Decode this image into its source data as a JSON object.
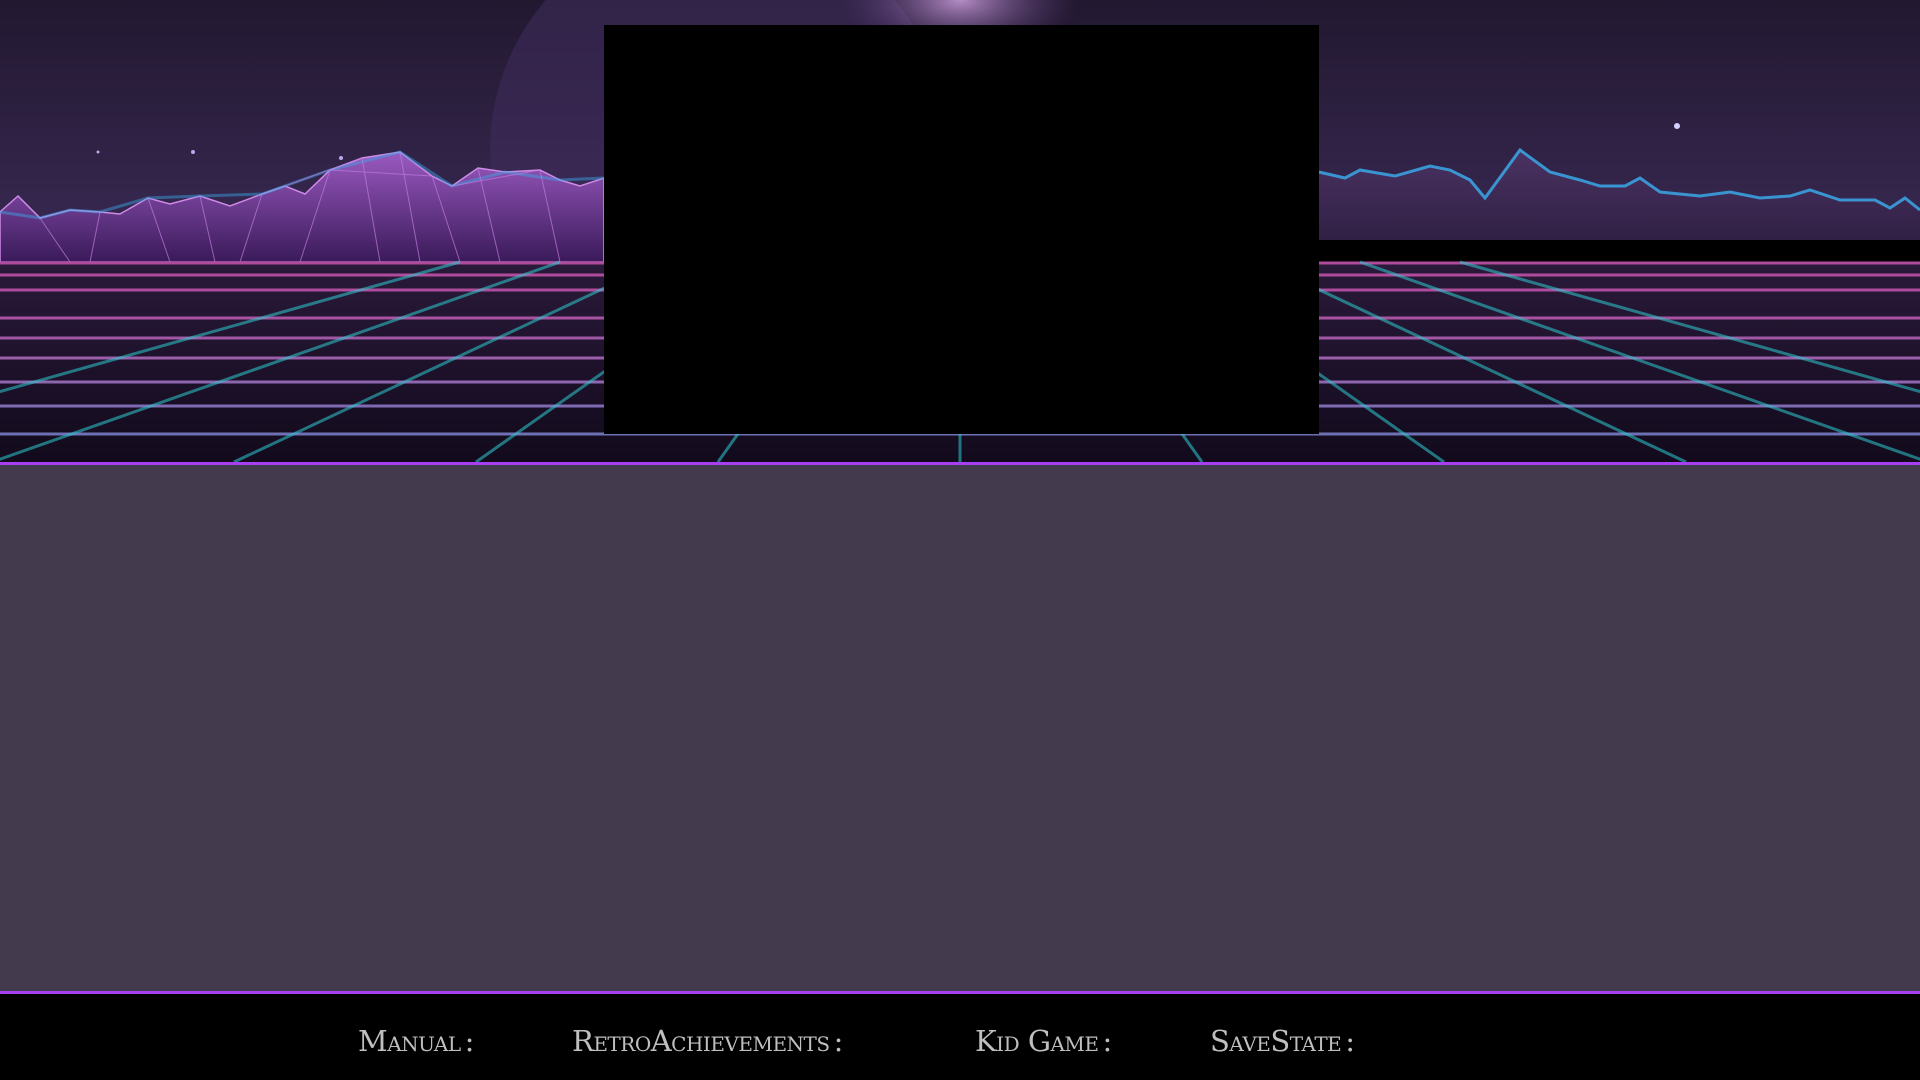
{
  "scene": {
    "theme": "synthwave-grid-landscape",
    "colors": {
      "sky_top": "#221830",
      "sky_bottom": "#3a2a55",
      "mountain_fill": "#4a2a6a",
      "mountain_glow": "#3aa8e8",
      "grid_pink": "#b04a9a",
      "grid_cyan": "#2ecbd0",
      "panel_bg": "#433a4d",
      "accent_line": "#a63ff0",
      "footer_label": "#bfbfbf"
    }
  },
  "footer": {
    "items": [
      {
        "label": "Manual",
        "value": ""
      },
      {
        "label": "RetroAchievements",
        "value": ""
      },
      {
        "label": "Kid Game",
        "value": ""
      },
      {
        "label": "SaveState",
        "value": ""
      }
    ]
  }
}
